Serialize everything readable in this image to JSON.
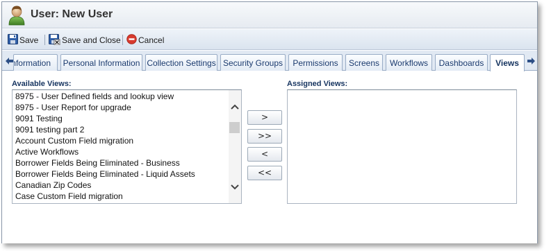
{
  "window": {
    "title": "User: New User"
  },
  "toolbar": {
    "save_label": "Save",
    "save_close_label": "Save and Close",
    "cancel_label": "Cancel"
  },
  "tabs": {
    "scroll_left_icon": "arrow-left-icon",
    "scroll_right_icon": "arrow-right-icon",
    "items": [
      {
        "label": "Information",
        "visible_text": "nformation"
      },
      {
        "label": "Personal Information"
      },
      {
        "label": "Collection Settings"
      },
      {
        "label": "Security Groups"
      },
      {
        "label": "Permissions"
      },
      {
        "label": "Screens"
      },
      {
        "label": "Workflows"
      },
      {
        "label": "Dashboards"
      },
      {
        "label": "Views",
        "active": true
      }
    ]
  },
  "views": {
    "available_label": "Available Views:",
    "assigned_label": "Assigned Views:",
    "available_items": [
      "8975 - User Defined fields and lookup view",
      "8975 - User Report for upgrade",
      "9091 Testing",
      "9091 testing part 2",
      "Account Custom Field migration",
      "Active Workflows",
      "Borrower Fields Being Eliminated - Business",
      "Borrower Fields Being Eliminated - Liquid Assets",
      "Canadian Zip Codes",
      "Case Custom Field migration"
    ],
    "assigned_items": [],
    "buttons": {
      "add_one": ">",
      "add_all": ">>",
      "remove_one": "<",
      "remove_all": "<<"
    }
  },
  "colors": {
    "accent": "#15335f",
    "tab_text": "#1a3a6e",
    "toolbar_bg": "#dbe4ef",
    "cancel_red": "#d83a2e"
  }
}
